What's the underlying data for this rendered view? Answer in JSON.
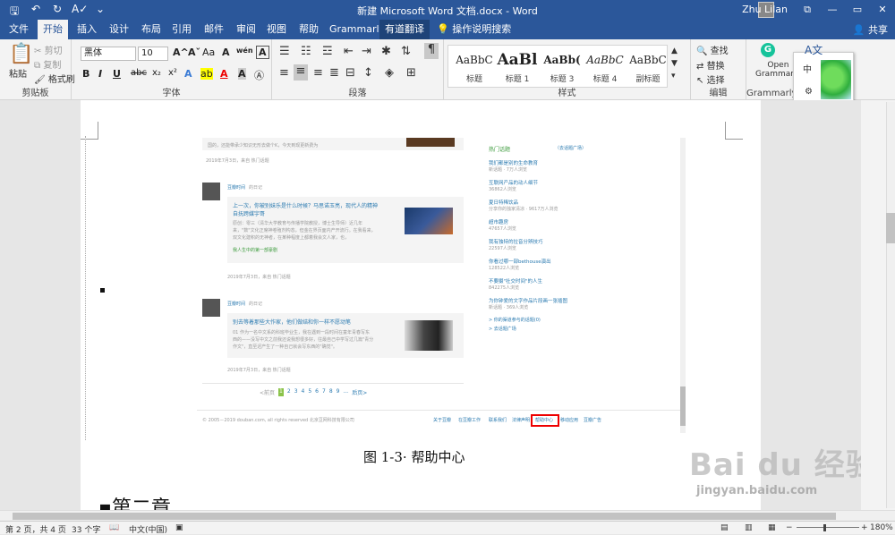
{
  "window": {
    "title": "新建 Microsoft Word 文档.docx  -  Word",
    "user_name": "Zhu Lilan",
    "controls": [
      "—",
      "⧉",
      "▭",
      "✕"
    ],
    "qat_icons": [
      "save-icon",
      "undo-icon",
      "redo-icon",
      "spell-icon",
      "customize-icon"
    ]
  },
  "tabs": [
    {
      "label": "文件",
      "state": "normal"
    },
    {
      "label": "开始",
      "state": "active"
    },
    {
      "label": "插入",
      "state": "normal"
    },
    {
      "label": "设计",
      "state": "normal"
    },
    {
      "label": "布局",
      "state": "normal"
    },
    {
      "label": "引用",
      "state": "normal"
    },
    {
      "label": "邮件",
      "state": "normal"
    },
    {
      "label": "审阅",
      "state": "normal"
    },
    {
      "label": "视图",
      "state": "normal"
    },
    {
      "label": "帮助",
      "state": "normal"
    },
    {
      "label": "Grammarly",
      "state": "normal"
    },
    {
      "label": "有道翻译",
      "state": "highlighted"
    }
  ],
  "tell_me": "操作说明搜索",
  "share_label": "共享",
  "ribbon": {
    "clipboard": {
      "paste": "粘贴",
      "cut": "剪切",
      "copy": "复制",
      "format_painter": "格式刷",
      "group_label": "剪贴板"
    },
    "font": {
      "font_name": "黑体",
      "font_size": "10",
      "grow": "A^",
      "shrink": "Aˇ",
      "case": "Aa",
      "clear": "A",
      "phonetic": "wén",
      "border_char": "A",
      "bold": "B",
      "italic": "I",
      "underline": "U",
      "strike": "abc",
      "subscript": "x₂",
      "superscript": "x²",
      "text_effects": "A",
      "highlight": "ab",
      "font_color": "A",
      "shading": "A",
      "circle_char": "Ⓐ",
      "group_label": "字体"
    },
    "paragraph": {
      "group_label": "段落"
    },
    "styles": {
      "items": [
        {
          "preview": "AaBbC",
          "name": "标题"
        },
        {
          "preview": "AaBl",
          "name": "标题 1"
        },
        {
          "preview": "AaBb(",
          "name": "标题 3"
        },
        {
          "preview": "AaBbC",
          "name": "标题 4"
        },
        {
          "preview": "AaBbC",
          "name": "副标题"
        }
      ],
      "group_label": "样式"
    },
    "editing": {
      "find": "查找",
      "replace": "替换",
      "select": "选择",
      "group_label": "编辑"
    },
    "grammarly": {
      "open_line1": "Open",
      "open_line2": "Grammarly",
      "group_label": "Grammarly"
    }
  },
  "document": {
    "caption": "图 1-3· 帮助中心",
    "heading": "▪第二章",
    "screenshot": {
      "snippet_top": "国的，还能带承少知识无形去做个K，今天到现更新费为",
      "date1": "2019年7月3日，来自 热门话题",
      "card1": {
        "author": "豆瓣时间",
        "suffix": "的日记",
        "title_line1": "上一次，你被别妹乐是什么时候？马思诺玉亮，现代人的精神",
        "title_line2": "自抚跨媒宇哥",
        "body_line1": "原创：零三（清华大学教育与传播学院教授，博士生导师）近几年",
        "body_line2": "来，\"数\"文化正席神卷殖剂构态，但金在界页面内产开流行。在我看来，",
        "body_line3": "双文化建积的无神者，在某种程度上都着我会文人家，也，",
        "tag": "我人生中的第一部豪剧"
      },
      "date2": "2019年7月3日，来自 热门话题",
      "card2": {
        "author": "豆瓣时间",
        "suffix": "的日记",
        "title": "别去等着那些大作家，他们做结和你一样不愿动笔",
        "body_line1": "01 作为一名中文系的科班毕业生，我在遇到一段时间在童年青春写东",
        "body_line2": "西的——没写中文之前我还说我想很多好，往最自己中学写过几篇\"青分",
        "body_line3": "作文\"，直至迟产生了一种自己就会写东西的\"确觉\"。"
      },
      "date3": "2019年7月3日，来自 热门话题",
      "pagination": {
        "prev": "<前页",
        "pages": [
          "1",
          "2",
          "3",
          "4",
          "5",
          "6",
          "7",
          "8",
          "9",
          "..."
        ],
        "next": "后页>"
      },
      "footer_copyright": "© 2005－2019 douban.com, all rights reserved 北京豆网科技有限公司",
      "footer_links": [
        "关于豆瓣",
        "在豆瓣工作",
        "联系我们",
        "法律声明",
        "帮助中心",
        "移动应用",
        "豆瓣广告"
      ],
      "hot_topics": {
        "title": "热门话题",
        "more": "（去话题广场）",
        "items": [
          {
            "title": "我们都是别的生命教育",
            "meta": "新话题 · 7万人浏览"
          },
          {
            "title": "互联网产品的动人细节",
            "meta": "36862人浏览"
          },
          {
            "title": "夏日特稀饮品",
            "meta": "分享你的独家清凉 · 9617万人浏览"
          },
          {
            "title": "超市趣房",
            "meta": "47657人浏览"
          },
          {
            "title": "我有独特的拉音分辨技巧",
            "meta": "22597人浏览"
          },
          {
            "title": "你看过哪一部bethouse演出",
            "meta": "128522人浏览"
          },
          {
            "title": "不要摄\"社交时间\"的人生",
            "meta": "842275人浏览"
          },
          {
            "title": "为你钟爱的文字作品片段画一张插图",
            "meta": "新话题 · 369人浏览"
          }
        ],
        "join": "> 你的渠道参与的话题(0)",
        "more_topics": "> 去话题广场"
      }
    }
  },
  "status": {
    "page": "第 2 页，共 4 页",
    "words": "33 个字",
    "language": "中文(中国)",
    "zoom": "180%"
  },
  "watermark": {
    "brand": "Bai du 经验",
    "url": "jingyan.baidu.com"
  }
}
